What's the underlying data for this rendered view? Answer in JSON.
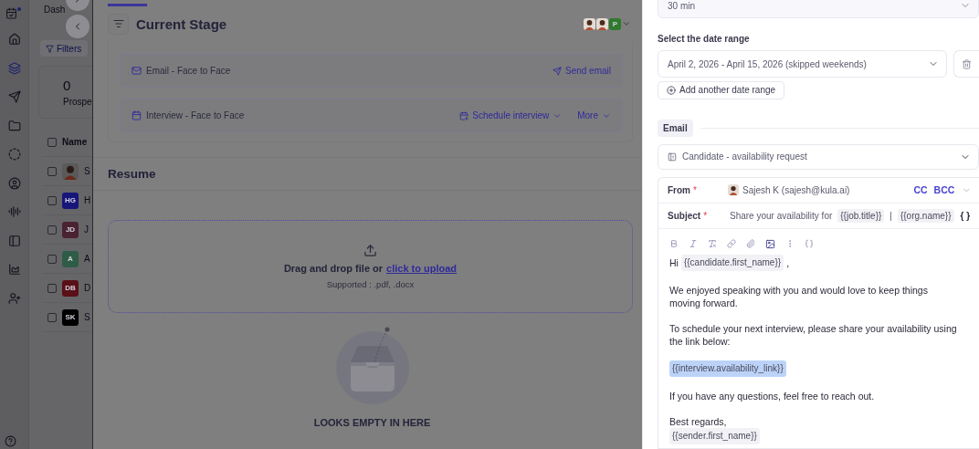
{
  "sidebar": {
    "nav_items": [
      {
        "selected": false
      },
      {
        "selected": true
      },
      {
        "selected": false
      },
      {
        "selected": false
      },
      {
        "selected": false
      },
      {
        "selected": false
      },
      {
        "selected": false
      },
      {
        "selected": false
      },
      {
        "selected": false
      },
      {
        "selected": false
      }
    ]
  },
  "list_panel": {
    "breadcrumb": "Dash",
    "filter_label": "Filters",
    "stat": {
      "value": "0",
      "label": "Prospe"
    },
    "column_header": {
      "label": "Name",
      "checked": false
    },
    "rows": [
      {
        "avatar": {
          "kind": "photo"
        },
        "name": "S",
        "checked": false
      },
      {
        "avatar": {
          "kind": "initials",
          "initials": "HG",
          "color": "#16167a"
        },
        "name": "H",
        "checked": false
      },
      {
        "avatar": {
          "kind": "initials",
          "initials": "JD",
          "color": "#4a2232"
        },
        "name": "J",
        "checked": false
      },
      {
        "avatar": {
          "kind": "initials",
          "initials": "A",
          "color": "#2f5c46"
        },
        "name": "A",
        "checked": false
      },
      {
        "avatar": {
          "kind": "initials",
          "initials": "DB",
          "color": "#5a1018"
        },
        "name": "D",
        "checked": false
      },
      {
        "avatar": {
          "kind": "initials",
          "initials": "SK",
          "color": "#000000"
        },
        "name": "S",
        "checked": false
      }
    ]
  },
  "stage_panel": {
    "title": "Current Stage",
    "assignees": [
      {
        "kind": "photo"
      },
      {
        "kind": "photo"
      },
      {
        "kind": "initials",
        "initials": "P",
        "color": "#2f7a2c"
      }
    ],
    "actions": [
      {
        "kind": "email",
        "label": "Email - Face to Face",
        "buttons": [
          {
            "label": "Send email",
            "has_caret": false
          }
        ]
      },
      {
        "kind": "interview",
        "label": "Interview - Face to Face",
        "buttons": [
          {
            "label": "Schedule interview",
            "has_caret": true
          },
          {
            "label": "More",
            "has_caret": true
          }
        ]
      }
    ]
  },
  "resume": {
    "title": "Resume",
    "upload": {
      "prompt": "Drag and drop file or",
      "link": "click to upload",
      "hint": "Supported : .pdf, .docx"
    },
    "empty_text": "LOOKS EMPTY IN HERE"
  },
  "drawer": {
    "duration_select": {
      "value": "30 min"
    },
    "date_range": {
      "label": "Select the date range",
      "ranges": [
        {
          "value": "April 2, 2026 - April 15, 2026 (skipped weekends)"
        }
      ],
      "add_button": "Add another date range"
    },
    "email": {
      "section_label": "Email",
      "template": {
        "value": "Candidate - availability request"
      },
      "from": {
        "label": "From",
        "required_mark": "*",
        "value": "Sajesh K (sajesh@kula.ai)"
      },
      "cc": "CC",
      "bcc": "BCC",
      "subject": {
        "label": "Subject",
        "required_mark": "*",
        "parts": [
          {
            "kind": "text",
            "text": "Share your availability for"
          },
          {
            "kind": "var",
            "text": "{{job.title}}"
          },
          {
            "kind": "text",
            "text": "|"
          },
          {
            "kind": "var",
            "text": "{{org.name}}"
          }
        ],
        "insert_label": "{ }"
      },
      "body": [
        {
          "lines": [
            [
              {
                "kind": "text",
                "text": "Hi"
              },
              {
                "kind": "var",
                "text": "{{candidate.first_name}}",
                "highlighted": false
              },
              {
                "kind": "text",
                "text": ","
              }
            ]
          ]
        },
        {
          "lines": [
            [
              {
                "kind": "text",
                "text": "We enjoyed speaking with you and would love to keep things moving forward."
              }
            ]
          ]
        },
        {
          "lines": [
            [
              {
                "kind": "text",
                "text": "To schedule your next interview, please share your availability using the link below:"
              }
            ]
          ]
        },
        {
          "lines": [
            [
              {
                "kind": "var",
                "text": "{{interview.availability_link}}",
                "highlighted": true
              }
            ]
          ]
        },
        {
          "lines": [
            [
              {
                "kind": "text",
                "text": "If you have any questions, feel free to reach out."
              }
            ]
          ]
        },
        {
          "lines": [
            [
              {
                "kind": "text",
                "text": "Best regards,"
              }
            ],
            [
              {
                "kind": "var",
                "text": "{{sender.first_name}}",
                "highlighted": false
              }
            ]
          ]
        }
      ]
    }
  }
}
